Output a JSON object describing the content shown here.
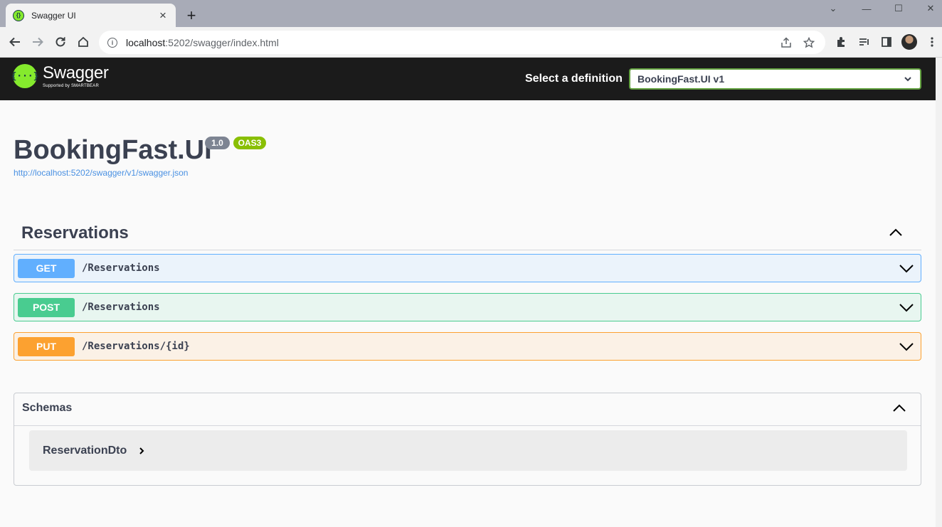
{
  "browser": {
    "tab_title": "Swagger UI",
    "tab_close": "×",
    "new_tab": "+",
    "url_host": "localhost",
    "url_path": ":5202/swagger/index.html",
    "window_controls": [
      "⌄",
      "—",
      "☐",
      "✕"
    ]
  },
  "topbar": {
    "logo_name": "Swagger",
    "logo_mark": "{···}",
    "logo_sub": "Supported by SMARTBEAR",
    "definition_label": "Select a definition",
    "definition_value": "BookingFast.UI v1"
  },
  "info": {
    "title": "BookingFast.UI",
    "version": "1.0",
    "oas": "OAS3",
    "spec_url": "http://localhost:5202/swagger/v1/swagger.json"
  },
  "tag": {
    "name": "Reservations",
    "operations": [
      {
        "method": "GET",
        "path": "/Reservations"
      },
      {
        "method": "POST",
        "path": "/Reservations"
      },
      {
        "method": "PUT",
        "path": "/Reservations/{id}"
      }
    ]
  },
  "schemas": {
    "title": "Schemas",
    "models": [
      "ReservationDto"
    ]
  },
  "colors": {
    "get": "#61affe",
    "post": "#49cc90",
    "put": "#fca130",
    "topbar": "#1b1b1b",
    "swagger_green": "#85ea2d"
  }
}
